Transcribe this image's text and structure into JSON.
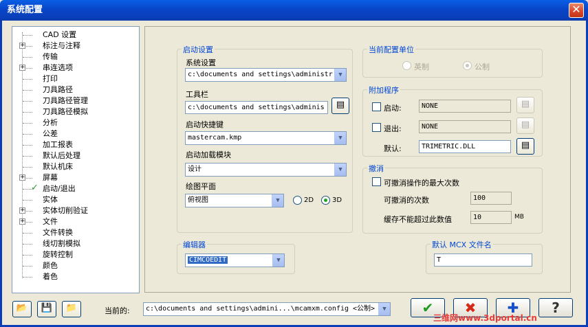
{
  "window": {
    "title": "系统配置",
    "close_glyph": "✕"
  },
  "tree": {
    "items": [
      {
        "label": "CAD 设置",
        "expandable": false
      },
      {
        "label": "标注与注释",
        "expandable": true
      },
      {
        "label": "传输",
        "expandable": false
      },
      {
        "label": "串连选项",
        "expandable": true
      },
      {
        "label": "打印",
        "expandable": false
      },
      {
        "label": "刀具路径",
        "expandable": false
      },
      {
        "label": "刀具路径管理",
        "expandable": false
      },
      {
        "label": "刀具路径模拟",
        "expandable": false
      },
      {
        "label": "分析",
        "expandable": false
      },
      {
        "label": "公差",
        "expandable": false
      },
      {
        "label": "加工报表",
        "expandable": false
      },
      {
        "label": "默认后处理",
        "expandable": false
      },
      {
        "label": "默认机床",
        "expandable": false
      },
      {
        "label": "屏幕",
        "expandable": true
      },
      {
        "label": "启动/退出",
        "expandable": false,
        "selected": true
      },
      {
        "label": "实体",
        "expandable": false
      },
      {
        "label": "实体切削验证",
        "expandable": true
      },
      {
        "label": "文件",
        "expandable": true
      },
      {
        "label": "文件转换",
        "expandable": false
      },
      {
        "label": "线切割模拟",
        "expandable": false
      },
      {
        "label": "旋转控制",
        "expandable": false
      },
      {
        "label": "颜色",
        "expandable": false
      },
      {
        "label": "着色",
        "expandable": false
      }
    ]
  },
  "startup": {
    "group_title": "启动设置",
    "system_label": "系统设置",
    "system_value": "c:\\documents and settings\\administr",
    "toolbar_label": "工具栏",
    "toolbar_value": "c:\\documents and settings\\adminis",
    "hotkey_label": "启动快捷键",
    "hotkey_value": "mastercam.kmp",
    "module_label": "启动加载模块",
    "module_value": "设计",
    "plane_label": "绘图平面",
    "plane_value": "俯视图",
    "radio_2d": "2D",
    "radio_3d": "3D"
  },
  "units": {
    "group_title": "当前配置单位",
    "imperial": "英制",
    "metric": "公制"
  },
  "addins": {
    "group_title": "附加程序",
    "startup_label": "启动:",
    "startup_value": "NONE",
    "exit_label": "退出:",
    "exit_value": "NONE",
    "default_label": "默认:",
    "default_value": "TRIMETRIC.DLL"
  },
  "undo": {
    "group_title": "撤消",
    "max_label": "可撤消操作的最大次数",
    "count_label": "可撤消的次数",
    "count_value": "100",
    "cache_label": "缓存不能超过此数值",
    "cache_value": "10",
    "cache_unit": "MB"
  },
  "editor": {
    "group_title": "编辑器",
    "value": "CIMCOEDIT"
  },
  "mcx": {
    "group_title": "默认 MCX 文件名",
    "value": "T"
  },
  "footer": {
    "current_label": "当前的:",
    "current_value": "c:\\documents and settings\\admini...\\mcamxm.config <公制>"
  },
  "buttons": {
    "ok_glyph": "✔",
    "cancel_glyph": "✖",
    "apply_glyph": "✚",
    "help_glyph": "?"
  },
  "watermark": "三维网www.3dportal.cn",
  "colors": {
    "titlebar": "#0a3eb8",
    "accent_text": "#0046d5",
    "ok": "#1e9b1e",
    "cancel": "#d42a1a",
    "apply": "#1450c8"
  }
}
